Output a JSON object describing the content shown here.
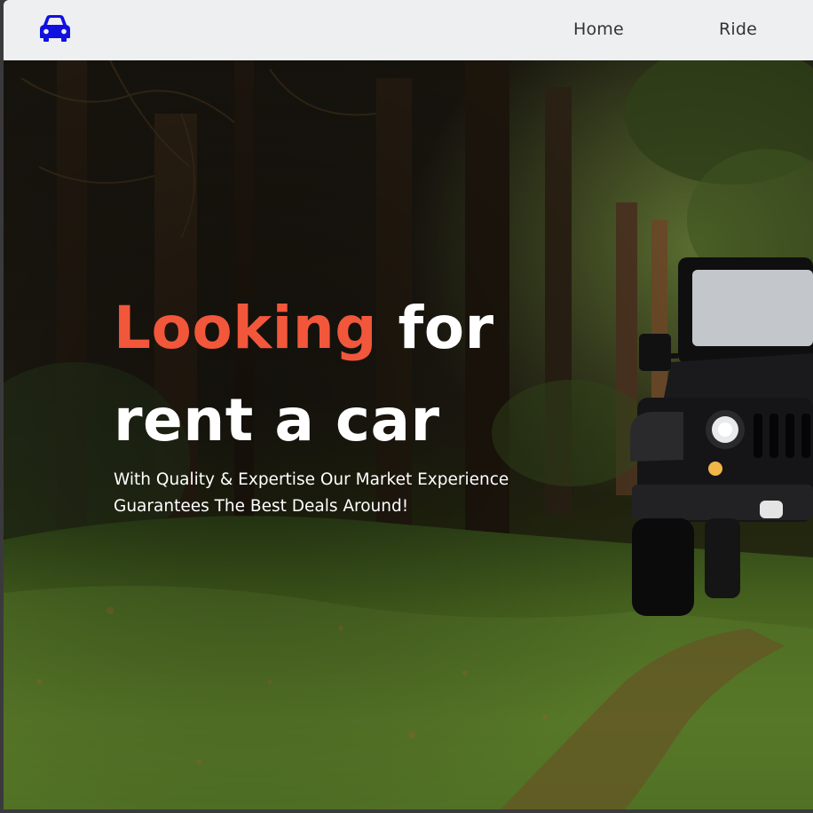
{
  "navbar": {
    "logo_icon": "car-icon",
    "logo_color": "#1010e0",
    "links": [
      {
        "label": "Home"
      },
      {
        "label": "Ride"
      }
    ]
  },
  "hero": {
    "title_accent": "Looking",
    "title_rest_line1": "for",
    "title_line2": "rent a car",
    "subtitle_line1": "With Quality & Expertise Our Market Experience",
    "subtitle_line2": "Guarantees The Best Deals Around!",
    "accent_color": "#f2573b"
  }
}
